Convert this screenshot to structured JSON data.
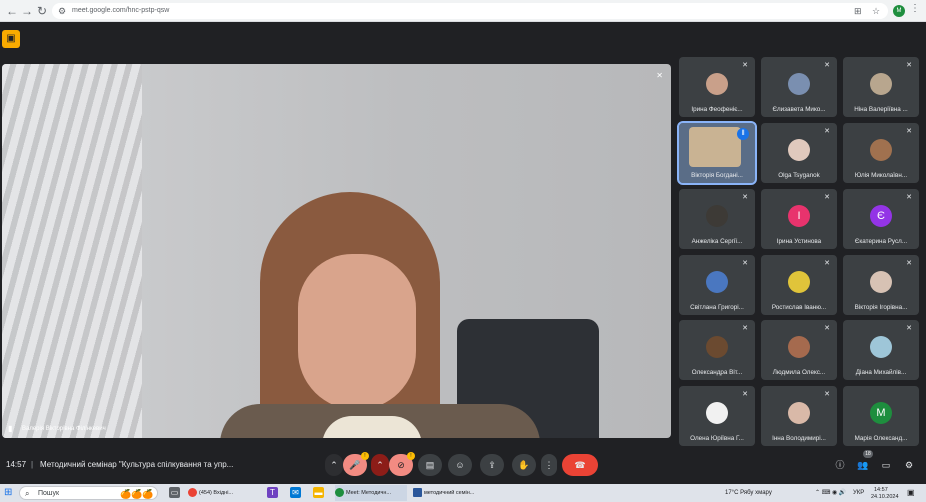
{
  "browser": {
    "url": "meet.google.com/hnc-pstp-qsw",
    "back": "←",
    "forward": "→",
    "reload": "↻",
    "translate_icon": "⊞",
    "star_icon": "☆",
    "profile": "М",
    "menu": "⋮"
  },
  "meet_app_icon": "▣",
  "main_speaker": {
    "name": "Валерія Вікторівна Філінкевич",
    "pin_icon": "📌",
    "mute_icon": "✕"
  },
  "participants": [
    {
      "name": "Ірина Феофеніє...",
      "avatar": "",
      "color": "#c9a08a",
      "muted": true,
      "active": false
    },
    {
      "name": "Єлизавета Мико...",
      "avatar": "",
      "color": "#7a8fb0",
      "muted": true,
      "active": false
    },
    {
      "name": "Ніна Валеріївна ...",
      "avatar": "",
      "color": "#b8a68e",
      "muted": true,
      "active": false
    },
    {
      "name": "Вікторія Богдані...",
      "avatar": "",
      "color": "#c9b393",
      "muted": false,
      "active": true
    },
    {
      "name": "Olga Tsyganok",
      "avatar": "",
      "color": "#e0c9bd",
      "muted": true,
      "active": false
    },
    {
      "name": "Юлія Миколаївн...",
      "avatar": "",
      "color": "#a0714f",
      "muted": true,
      "active": false
    },
    {
      "name": "Анжеліка Сергії...",
      "avatar": "",
      "color": "#3d3a36",
      "muted": true,
      "active": false
    },
    {
      "name": "Ірина Устинова",
      "avatar": "І",
      "color": "#e8336d",
      "muted": true,
      "active": false
    },
    {
      "name": "Єкатерина Русл...",
      "avatar": "Є",
      "color": "#9334e6",
      "muted": true,
      "active": false
    },
    {
      "name": "Світлана Григорі...",
      "avatar": "",
      "color": "#4a77c0",
      "muted": true,
      "active": false
    },
    {
      "name": "Ростислав Іваню...",
      "avatar": "",
      "color": "#e0c43a",
      "muted": true,
      "active": false
    },
    {
      "name": "Вікторія Ігорівна...",
      "avatar": "",
      "color": "#d7c2b4",
      "muted": true,
      "active": false
    },
    {
      "name": "Олександра Віт...",
      "avatar": "",
      "color": "#6b4a30",
      "muted": true,
      "active": false
    },
    {
      "name": "Людмила Олекс...",
      "avatar": "",
      "color": "#a56a4e",
      "muted": true,
      "active": false
    },
    {
      "name": "Діана Михайлів...",
      "avatar": "",
      "color": "#9ec6d8",
      "muted": true,
      "active": false
    },
    {
      "name": "Олена Юріївна Г...",
      "avatar": "",
      "color": "#f1f1f1",
      "muted": true,
      "active": false
    },
    {
      "name": "Інна Володимирі...",
      "avatar": "",
      "color": "#d9b9a8",
      "muted": true,
      "active": false
    },
    {
      "name": "Марія Олександ...",
      "avatar": "М",
      "color": "#1e8e3e",
      "muted": false,
      "active": false
    }
  ],
  "bottom_bar": {
    "time": "14:57",
    "separator": "|",
    "meeting_title": "Методичний семінар \"Культура спілкування та упр...",
    "controls": {
      "more_arrow": "⌃",
      "mic": "🎤",
      "mic_badge": "!",
      "cam_arrow": "⌃",
      "cam": "⊘",
      "cam_badge": "!",
      "captions": "▤",
      "emoji": "☺",
      "present": "⇪",
      "raise_hand": "✋",
      "more": "⋮",
      "leave": "☎"
    },
    "right": {
      "info": "ⓘ",
      "people": "👥",
      "people_count": "18",
      "chat": "▭",
      "activities": "⚙"
    }
  },
  "taskbar": {
    "start": "⊞",
    "search_placeholder": "Пошук",
    "search_icon": "⌕",
    "oranges": "🍊🍊🍊",
    "apps": [
      {
        "label": "(454) Вхідні...",
        "color": "#ea4335"
      },
      {
        "label": "Meet: Методичн...",
        "color": "#1e8e3e"
      },
      {
        "label": "методичний семін...",
        "color": "#2b579a"
      }
    ],
    "weather": "17°C Рябу хмару",
    "lang": "УКР",
    "clock_time": "14:57",
    "clock_date": "24.10.2024"
  }
}
